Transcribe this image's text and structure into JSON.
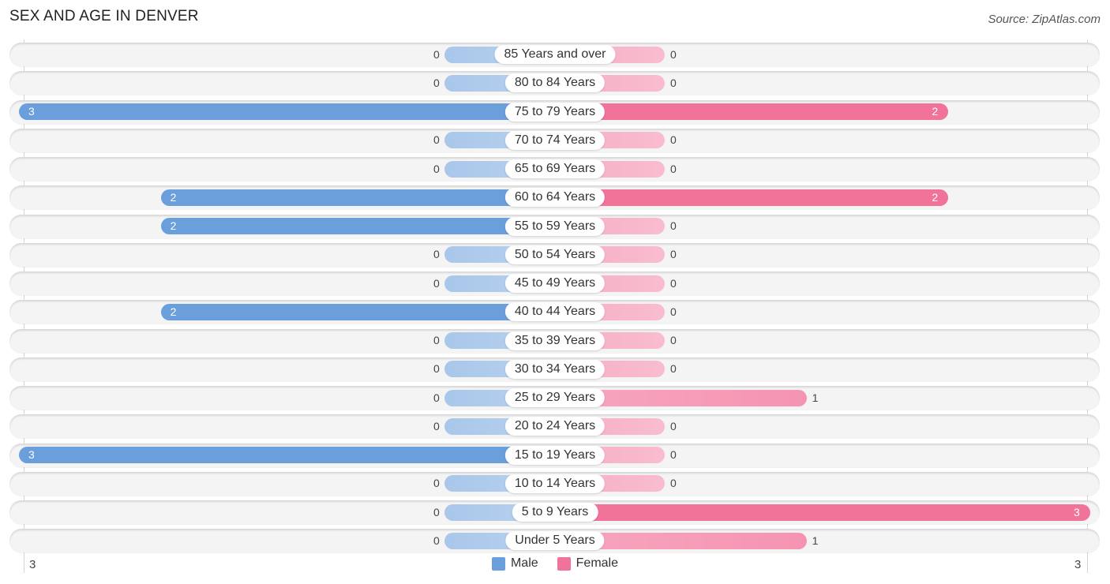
{
  "title": "SEX AND AGE IN DENVER",
  "source": "Source: ZipAtlas.com",
  "colors": {
    "male": "#6a9fdc",
    "female": "#f27399"
  },
  "chart_data": {
    "type": "bar",
    "orientation": "horizontal-diverging",
    "title": "SEX AND AGE IN DENVER",
    "categories": [
      "85 Years and over",
      "80 to 84 Years",
      "75 to 79 Years",
      "70 to 74 Years",
      "65 to 69 Years",
      "60 to 64 Years",
      "55 to 59 Years",
      "50 to 54 Years",
      "45 to 49 Years",
      "40 to 44 Years",
      "35 to 39 Years",
      "30 to 34 Years",
      "25 to 29 Years",
      "20 to 24 Years",
      "15 to 19 Years",
      "10 to 14 Years",
      "5 to 9 Years",
      "Under 5 Years"
    ],
    "series": [
      {
        "name": "Male",
        "values": [
          0,
          0,
          3,
          0,
          0,
          2,
          2,
          0,
          0,
          2,
          0,
          0,
          0,
          0,
          3,
          0,
          0,
          0
        ]
      },
      {
        "name": "Female",
        "values": [
          0,
          0,
          2,
          0,
          0,
          2,
          0,
          0,
          0,
          0,
          0,
          0,
          1,
          0,
          0,
          0,
          3,
          1
        ]
      }
    ],
    "axis": {
      "left_tick": "3",
      "right_tick": "3",
      "max": 3
    },
    "legend": {
      "position": "bottom-center",
      "entries": [
        "Male",
        "Female"
      ]
    },
    "xlabel": "",
    "ylabel": ""
  }
}
